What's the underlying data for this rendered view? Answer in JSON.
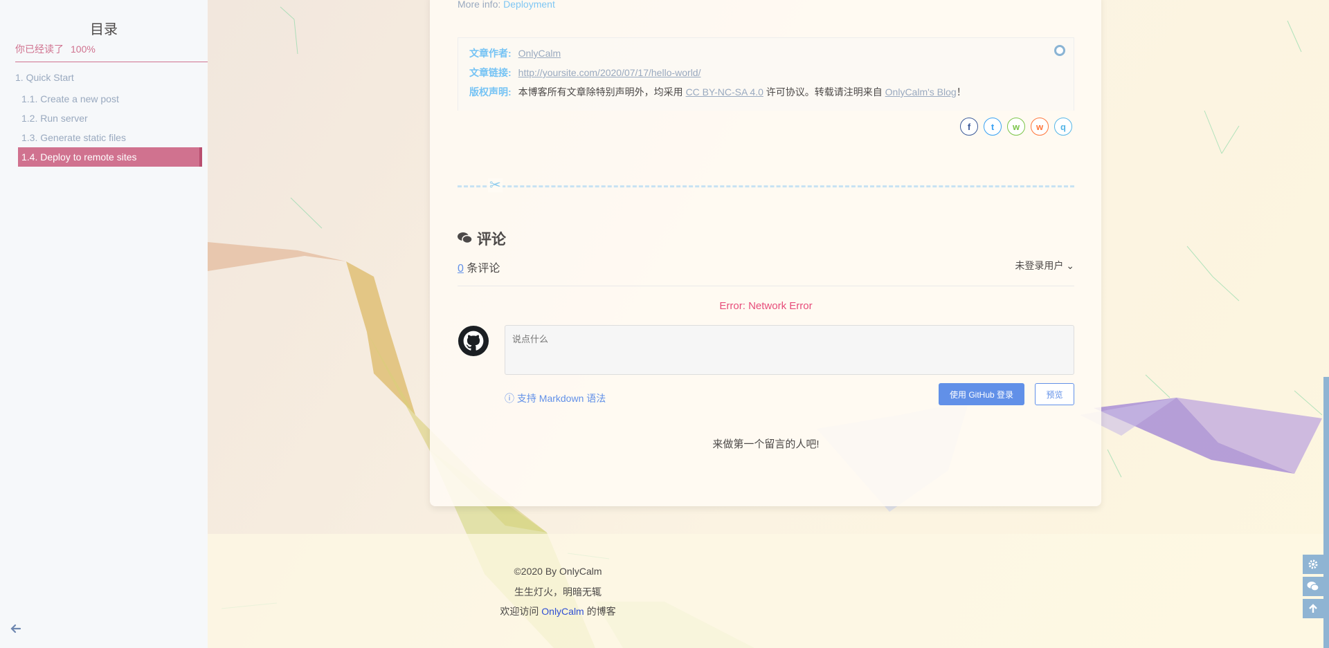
{
  "sidebar": {
    "title": "目录",
    "progress_label": "你已经读了",
    "progress_value": "100%",
    "items": [
      {
        "label": "1. Quick Start",
        "level": 1,
        "active": false
      },
      {
        "label": "1.1. Create a new post",
        "level": 2,
        "active": false
      },
      {
        "label": "1.2. Run server",
        "level": 2,
        "active": false
      },
      {
        "label": "1.3. Generate static files",
        "level": 2,
        "active": false
      },
      {
        "label": "1.4. Deploy to remote sites",
        "level": 2,
        "active": true
      }
    ]
  },
  "post": {
    "more_info_label": "More info:",
    "more_info_link": "Deployment"
  },
  "copyright": {
    "author_label": "文章作者:",
    "author": "OnlyCalm",
    "link_label": "文章链接:",
    "link": "http://yoursite.com/2020/07/17/hello-world/",
    "license_label": "版权声明:",
    "license_prefix": "本博客所有文章除特别声明外，均采用",
    "license_name": "CC BY-NC-SA 4.0",
    "license_middle": "许可协议。转载请注明来自",
    "blog_name": "OnlyCalm's Blog",
    "license_suffix": "！"
  },
  "share": [
    {
      "icon": "facebook-icon",
      "glyph": "f",
      "color": "#3b5998"
    },
    {
      "icon": "twitter-icon",
      "glyph": "t",
      "color": "#38a1f3"
    },
    {
      "icon": "wechat-icon",
      "glyph": "w",
      "color": "#7bc549"
    },
    {
      "icon": "weibo-icon",
      "glyph": "w",
      "color": "#ff763b"
    },
    {
      "icon": "qq-icon",
      "glyph": "q",
      "color": "#56b6e7"
    }
  ],
  "comments": {
    "heading": "评论",
    "count": "0",
    "count_suffix": "条评论",
    "user_menu": "未登录用户",
    "error": "Error: Network Error",
    "placeholder": "说点什么",
    "markdown_tip": "支持 Markdown 语法",
    "login_button": "使用 GitHub 登录",
    "preview_button": "预览",
    "empty_message": "来做第一个留言的人吧!"
  },
  "footer": {
    "copyright": "©2020 By OnlyCalm",
    "slogan": "生生灯火，明暗无辄",
    "welcome_prefix": "欢迎访问",
    "welcome_link": "OnlyCalm",
    "welcome_suffix": "的博客"
  },
  "colors": {
    "accent": "#d0728f",
    "link_blue": "#49b1f5",
    "gitalk_blue": "#6190e8",
    "error_pink": "#e74c7a",
    "side_button": "#8fb4d3"
  }
}
